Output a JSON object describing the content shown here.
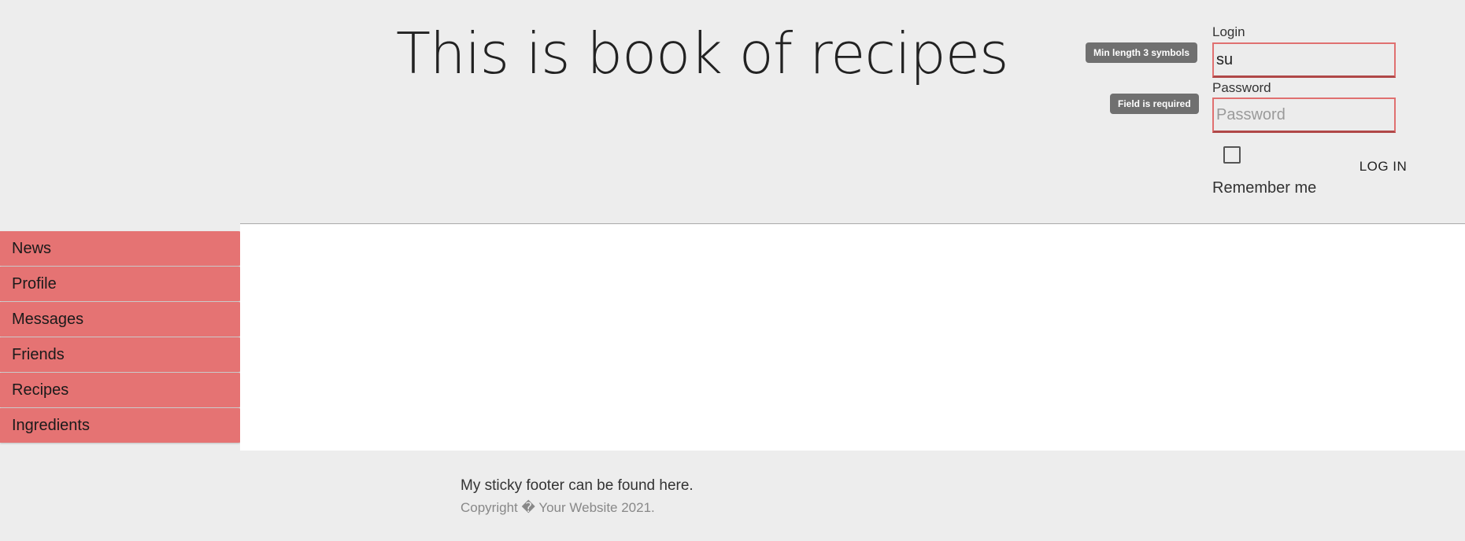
{
  "header": {
    "title": "This is book of recipes"
  },
  "login_form": {
    "login_label": "Login",
    "login_value": "su",
    "login_error": "Min length 3 symbols",
    "password_label": "Password",
    "password_placeholder": "Password",
    "password_error": "Field is required",
    "remember_label": "Remember me",
    "remember_checked": false,
    "submit_label": "LOG IN"
  },
  "sidebar": {
    "items": [
      {
        "label": "News"
      },
      {
        "label": "Profile"
      },
      {
        "label": "Messages"
      },
      {
        "label": "Friends"
      },
      {
        "label": "Recipes"
      },
      {
        "label": "Ingredients"
      }
    ]
  },
  "footer": {
    "text": "My sticky footer can be found here.",
    "copyright": "Copyright � Your Website 2021."
  },
  "colors": {
    "accent": "#e57373",
    "error_border": "#e07070",
    "tooltip_bg": "#707070",
    "background": "#ededed"
  }
}
